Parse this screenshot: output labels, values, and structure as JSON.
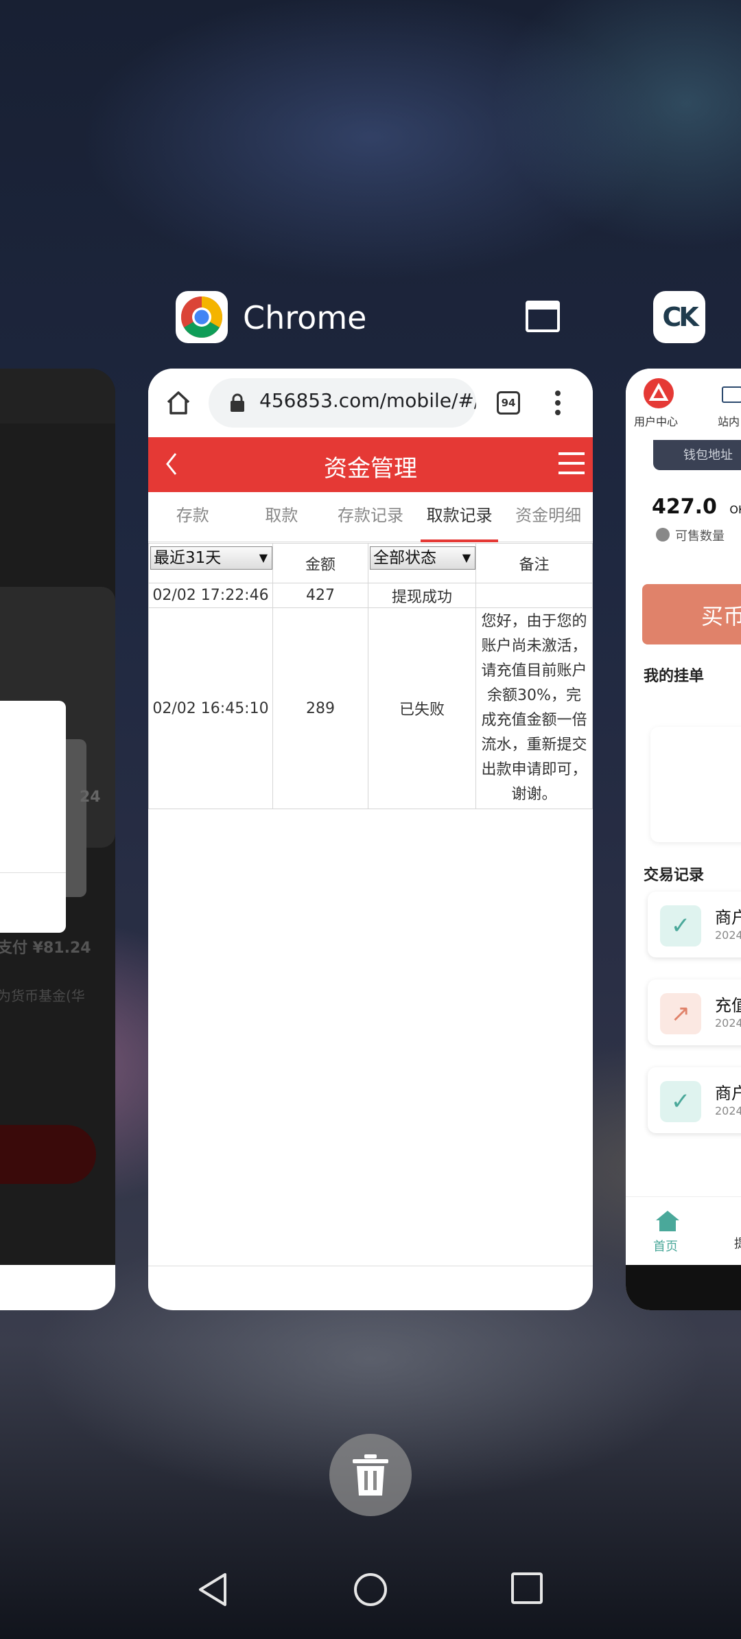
{
  "recents": {
    "center_app": {
      "name": "Chrome"
    },
    "right_app": {
      "icon_text": "CK"
    }
  },
  "chrome": {
    "url": "456853.com/mobile/#/",
    "tab_count": "94"
  },
  "page": {
    "title": "资金管理",
    "tabs": [
      {
        "label": "存款",
        "active": false
      },
      {
        "label": "取款",
        "active": false
      },
      {
        "label": "存款记录",
        "active": false
      },
      {
        "label": "取款记录",
        "active": true
      },
      {
        "label": "资金明细",
        "active": false
      }
    ],
    "filter_date": "最近31天",
    "col_amount": "金额",
    "filter_status": "全部状态",
    "col_note": "备注",
    "rows": [
      {
        "time": "02/02 17:22:46",
        "amount": "427",
        "status": "提现成功",
        "note": ""
      },
      {
        "time": "02/02 16:45:10",
        "amount": "289",
        "status": "已失败",
        "note": "您好，由于您的账户尚未激活，请充值目前账户余额30%，完成充值金额一倍流水，重新提交出款申请即可，谢谢。"
      }
    ]
  },
  "left_card": {
    "text_pay": "支付 ¥81.24",
    "text_fund": "为货币基金(华",
    "text_partial": "24"
  },
  "right_card": {
    "nav_user": "用户中心",
    "nav_station": "站内",
    "wallet": "钱包地址",
    "amount": "427.0",
    "amount_unit": "OK",
    "sellable": "可售数量",
    "buy_button": "买币",
    "my_orders": "我的挂单",
    "trade_records": "交易记录",
    "records": [
      {
        "title": "商户",
        "date": "2024",
        "kind": "check"
      },
      {
        "title": "充值",
        "date": "2024",
        "kind": "arrow"
      },
      {
        "title": "商户",
        "date": "2024",
        "kind": "check"
      }
    ],
    "bottom_home": "首页",
    "bottom_next": "提"
  },
  "colors": {
    "accent_red": "#e53935",
    "teal": "#4aa89a",
    "salmon": "#e0826a"
  }
}
